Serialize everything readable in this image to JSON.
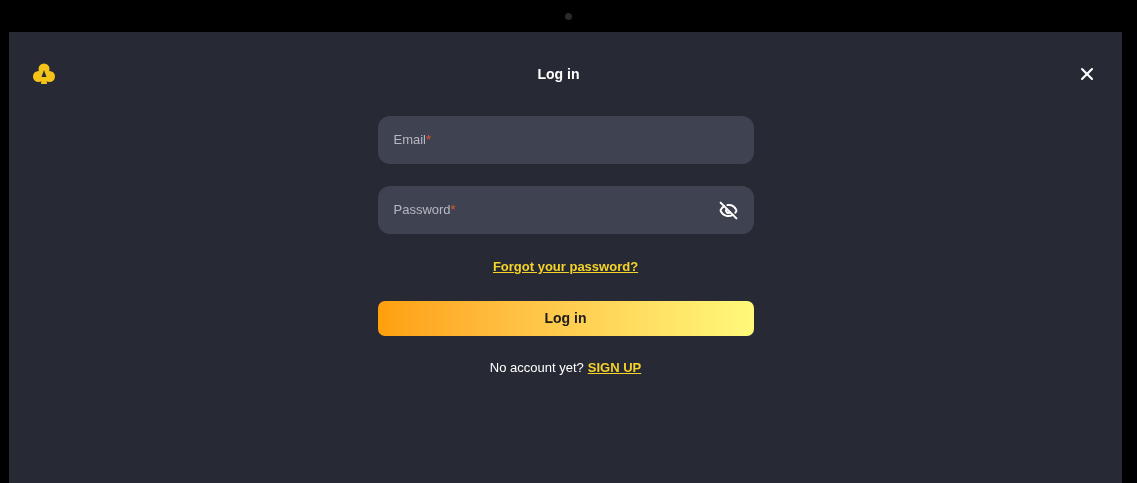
{
  "dialog": {
    "title": "Log in"
  },
  "fields": [
    {
      "kind": "text",
      "placeholder": "Email",
      "required_mark": "*"
    },
    {
      "kind": "password",
      "placeholder": "Password",
      "required_mark": "*",
      "password_visible": false
    }
  ],
  "forgot_link": "Forgot your password?",
  "submit_button": "Log in",
  "signup": {
    "prompt": "No account yet?",
    "link": "SIGN UP"
  }
}
